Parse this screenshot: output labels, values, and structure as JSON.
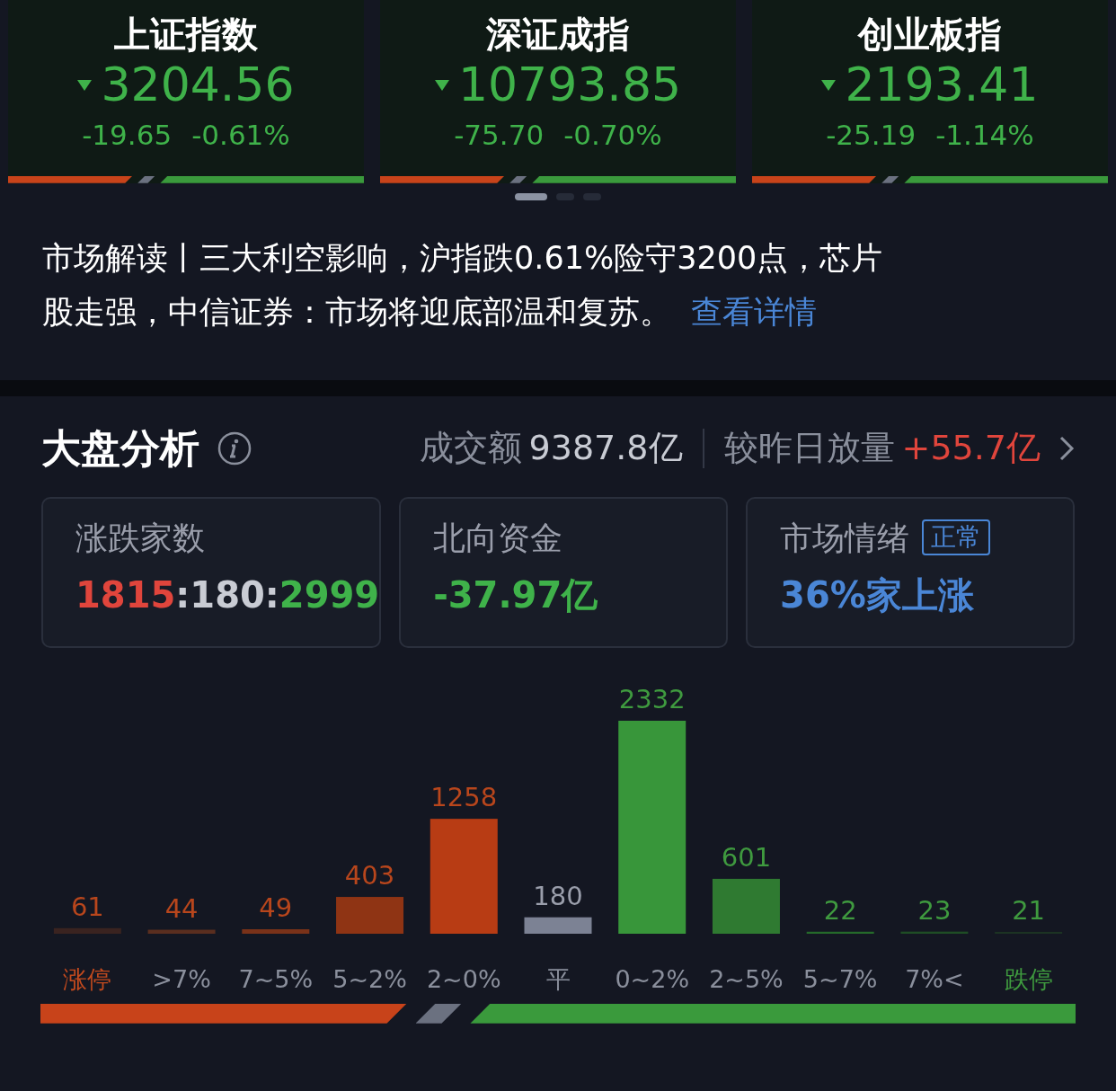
{
  "indices": [
    {
      "name": "上证指数",
      "value": "3204.56",
      "change": "-19.65",
      "percent": "-0.61%"
    },
    {
      "name": "深证成指",
      "value": "10793.85",
      "change": "-75.70",
      "percent": "-0.70%"
    },
    {
      "name": "创业板指",
      "value": "2193.41",
      "change": "-25.19",
      "percent": "-1.14%"
    }
  ],
  "pager": [
    {
      "selected": true
    },
    {
      "selected": false
    },
    {
      "selected": false
    }
  ],
  "news": {
    "lines": [
      "市场解读丨三大利空影响，沪指跌0.61%险守3200点，芯片",
      "股走强，中信证券：市场将迎底部温和复苏。"
    ],
    "link": "查看详情"
  },
  "analysis": {
    "title": "大盘分析",
    "turnover_label": "成交额",
    "turnover": "9387.8亿",
    "compare_label": "较昨日放量",
    "compare": "+55.7亿",
    "cards": [
      {
        "kind": "ratio",
        "label": "涨跌家数",
        "up": "1815",
        "sep1": ":",
        "flat": "180",
        "sep2": ":",
        "down": "2999"
      },
      {
        "kind": "flow",
        "label": "北向资金",
        "value": "-37.97亿"
      },
      {
        "kind": "mood",
        "label": "市场情绪",
        "tag": "正常",
        "value": "36%家上涨"
      }
    ],
    "chart_data": {
      "type": "bar",
      "categories": [
        "涨停",
        ">7%",
        "7~5%",
        "5~2%",
        "2~0%",
        "平",
        "0~2%",
        "2~5%",
        "5~7%",
        "7%<",
        "跌停"
      ],
      "values": [
        61,
        44,
        49,
        403,
        1258,
        180,
        2332,
        601,
        22,
        23,
        21
      ],
      "data_labels": true
    }
  }
}
